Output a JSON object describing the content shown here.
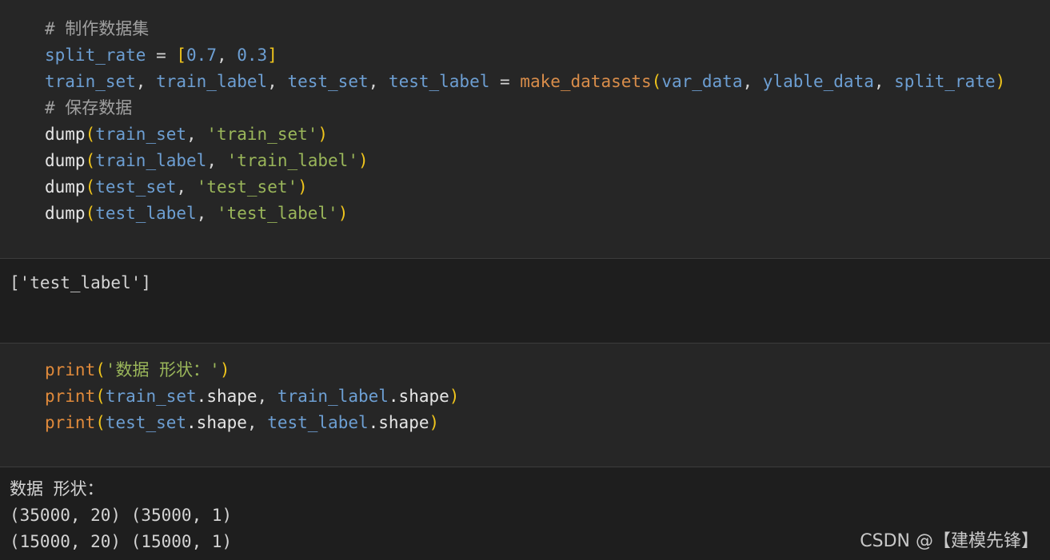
{
  "cells": {
    "code1": {
      "lines": [
        [
          {
            "t": "# 制作数据集",
            "k": "comment"
          }
        ],
        [
          {
            "t": "split_rate",
            "k": "var"
          },
          {
            "t": " = ",
            "k": "op"
          },
          {
            "t": "[",
            "k": "bracket"
          },
          {
            "t": "0.7",
            "k": "num"
          },
          {
            "t": ", ",
            "k": "op"
          },
          {
            "t": "0.3",
            "k": "num"
          },
          {
            "t": "]",
            "k": "bracket"
          }
        ],
        [
          {
            "t": "train_set",
            "k": "var"
          },
          {
            "t": ", ",
            "k": "op"
          },
          {
            "t": "train_label",
            "k": "var"
          },
          {
            "t": ", ",
            "k": "op"
          },
          {
            "t": "test_set",
            "k": "var"
          },
          {
            "t": ", ",
            "k": "op"
          },
          {
            "t": "test_label",
            "k": "var"
          },
          {
            "t": " = ",
            "k": "op"
          },
          {
            "t": "make_datasets",
            "k": "fn"
          },
          {
            "t": "(",
            "k": "bracket"
          },
          {
            "t": "var_data",
            "k": "var"
          },
          {
            "t": ", ",
            "k": "op"
          },
          {
            "t": "ylable_data",
            "k": "var"
          },
          {
            "t": ", ",
            "k": "op"
          },
          {
            "t": "split_rate",
            "k": "var"
          },
          {
            "t": ")",
            "k": "bracket"
          }
        ],
        [
          {
            "t": "# 保存数据",
            "k": "comment"
          }
        ],
        [
          {
            "t": "dump",
            "k": "call"
          },
          {
            "t": "(",
            "k": "bracket"
          },
          {
            "t": "train_set",
            "k": "var"
          },
          {
            "t": ", ",
            "k": "op"
          },
          {
            "t": "'train_set'",
            "k": "str"
          },
          {
            "t": ")",
            "k": "bracket"
          }
        ],
        [
          {
            "t": "dump",
            "k": "call"
          },
          {
            "t": "(",
            "k": "bracket"
          },
          {
            "t": "train_label",
            "k": "var"
          },
          {
            "t": ", ",
            "k": "op"
          },
          {
            "t": "'train_label'",
            "k": "str"
          },
          {
            "t": ")",
            "k": "bracket"
          }
        ],
        [
          {
            "t": "dump",
            "k": "call"
          },
          {
            "t": "(",
            "k": "bracket"
          },
          {
            "t": "test_set",
            "k": "var"
          },
          {
            "t": ", ",
            "k": "op"
          },
          {
            "t": "'test_set'",
            "k": "str"
          },
          {
            "t": ")",
            "k": "bracket"
          }
        ],
        [
          {
            "t": "dump",
            "k": "call"
          },
          {
            "t": "(",
            "k": "bracket"
          },
          {
            "t": "test_label",
            "k": "var"
          },
          {
            "t": ", ",
            "k": "op"
          },
          {
            "t": "'test_label'",
            "k": "str"
          },
          {
            "t": ")",
            "k": "bracket"
          }
        ]
      ]
    },
    "output1": {
      "lines": [
        "['test_label']"
      ]
    },
    "code2": {
      "lines": [
        [
          {
            "t": "print",
            "k": "builtin"
          },
          {
            "t": "(",
            "k": "bracket"
          },
          {
            "t": "'数据 形状：'",
            "k": "str"
          },
          {
            "t": ")",
            "k": "bracket"
          }
        ],
        [
          {
            "t": "print",
            "k": "builtin"
          },
          {
            "t": "(",
            "k": "bracket"
          },
          {
            "t": "train_set",
            "k": "var"
          },
          {
            "t": ".shape",
            "k": "attr"
          },
          {
            "t": ", ",
            "k": "op"
          },
          {
            "t": "train_label",
            "k": "var"
          },
          {
            "t": ".shape",
            "k": "attr"
          },
          {
            "t": ")",
            "k": "bracket"
          }
        ],
        [
          {
            "t": "print",
            "k": "builtin"
          },
          {
            "t": "(",
            "k": "bracket"
          },
          {
            "t": "test_set",
            "k": "var"
          },
          {
            "t": ".shape",
            "k": "attr"
          },
          {
            "t": ", ",
            "k": "op"
          },
          {
            "t": "test_label",
            "k": "var"
          },
          {
            "t": ".shape",
            "k": "attr"
          },
          {
            "t": ")",
            "k": "bracket"
          }
        ]
      ]
    },
    "output2": {
      "lines": [
        "数据 形状：",
        "(35000, 20) (35000, 1)",
        "(15000, 20) (15000, 1)"
      ]
    }
  },
  "watermark": {
    "text": "CSDN @【建模先锋】"
  }
}
